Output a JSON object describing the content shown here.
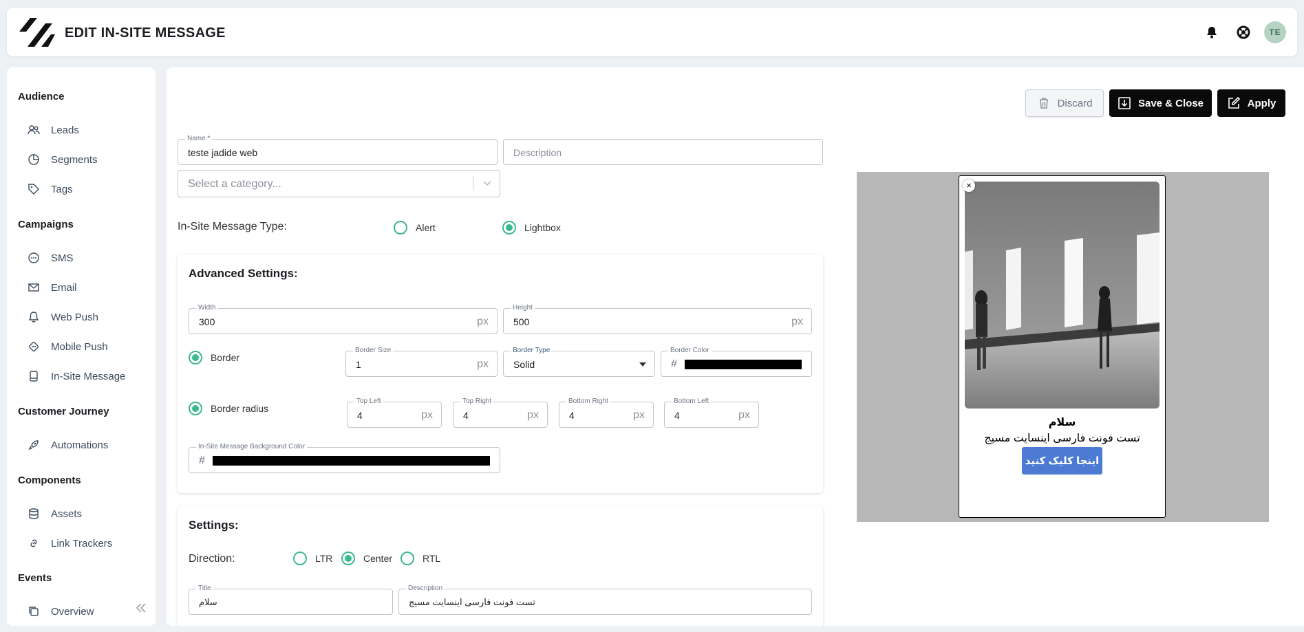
{
  "header": {
    "title": "EDIT IN-SITE MESSAGE",
    "avatar_initials": "TE"
  },
  "sidebar": {
    "sections": [
      {
        "label": "Audience"
      },
      {
        "label": "Campaigns"
      },
      {
        "label": "Customer Journey"
      },
      {
        "label": "Components"
      },
      {
        "label": "Events"
      }
    ],
    "items": [
      {
        "label": "Leads",
        "icon": "users-icon"
      },
      {
        "label": "Segments",
        "icon": "pie-chart-icon"
      },
      {
        "label": "Tags",
        "icon": "tag-icon"
      },
      {
        "label": "SMS",
        "icon": "chat-bubble-icon"
      },
      {
        "label": "Email",
        "icon": "envelope-icon"
      },
      {
        "label": "Web Push",
        "icon": "bell-icon"
      },
      {
        "label": "Mobile Push",
        "icon": "mobile-push-icon"
      },
      {
        "label": "In-Site Message",
        "icon": "in-site-message-icon"
      },
      {
        "label": "Automations",
        "icon": "rocket-icon"
      },
      {
        "label": "Assets",
        "icon": "database-icon"
      },
      {
        "label": "Link Trackers",
        "icon": "link-icon"
      },
      {
        "label": "Overview",
        "icon": "overview-icon"
      }
    ]
  },
  "toolbar": {
    "discard_label": "Discard",
    "save_close_label": "Save & Close",
    "apply_label": "Apply"
  },
  "form": {
    "name_label": "Name *",
    "name_value": "teste jadide web",
    "description_placeholder": "Description",
    "category_placeholder": "Select a category...",
    "type_label": "In-Site Message Type:",
    "type_options": [
      "Alert",
      "Lightbox"
    ],
    "type_selected": "Lightbox"
  },
  "advanced": {
    "title": "Advanced Settings:",
    "width_label": "Width",
    "width_value": "300",
    "height_label": "Height",
    "height_value": "500",
    "unit": "px",
    "border_label": "Border",
    "border_size_label": "Border Size",
    "border_size_value": "1",
    "border_type_label": "Border Type",
    "border_type_value": "Solid",
    "border_color_label": "Border Color",
    "border_color": "#000000",
    "hash": "#",
    "radius_label": "Border radius",
    "top_left_label": "Top Left",
    "top_left_value": "4",
    "top_right_label": "Top Right",
    "top_right_value": "4",
    "bottom_right_label": "Bottom Right",
    "bottom_right_value": "4",
    "bottom_left_label": "Bottom Left",
    "bottom_left_value": "4",
    "bg_color_label": "In-Site Message Background Color",
    "bg_color": "#000000"
  },
  "settings": {
    "title": "Settings:",
    "direction_label": "Direction:",
    "direction_options": [
      "LTR",
      "Center",
      "RTL"
    ],
    "direction_selected": "Center",
    "title_label": "Title",
    "title_value": "سلام",
    "description_label": "Description",
    "description_value": "تست فونت فارسی اینسایت مسیج"
  },
  "preview": {
    "title": "سلام",
    "description": "تست فونت فارسی اینسایت مسیج",
    "button_label": "اینجا کلیک کنید",
    "close_glyph": "×",
    "button_color": "#4d7bd3",
    "backdrop_color": "#b7b7b7"
  },
  "colors": {
    "accent": "#3cb98c",
    "primary_button": "#0a0a0a"
  }
}
